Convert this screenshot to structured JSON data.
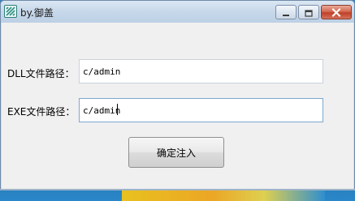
{
  "window": {
    "title": "by.御盖",
    "icon": "app-logo-icon",
    "controls": {
      "minimize_icon": "minimize-icon",
      "maximize_icon": "maximize-icon",
      "close_icon": "close-icon"
    },
    "accent_close": "#c0412a"
  },
  "form": {
    "dll": {
      "label": "DLL文件路径：",
      "value": "c/admin"
    },
    "exe": {
      "label": "EXE文件路径：",
      "value": "c/admin"
    },
    "submit_label": "确定注入"
  }
}
